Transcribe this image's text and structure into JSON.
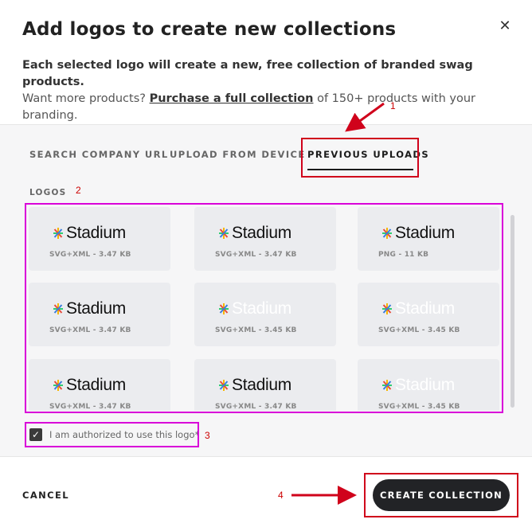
{
  "modal": {
    "title": "Add logos to create new collections",
    "description": {
      "line1": "Each selected logo will create a new, free collection of branded swag products.",
      "prefix": "Want more products? ",
      "link": "Purchase a full collection",
      "suffix": " of 150+ products with your branding."
    }
  },
  "tabs": [
    {
      "label": "SEARCH COMPANY URL",
      "active": false
    },
    {
      "label": "UPLOAD FROM DEVICE",
      "active": false
    },
    {
      "label": "PREVIOUS UPLOADS",
      "active": true
    }
  ],
  "logos_label": "LOGOS",
  "logos": [
    {
      "name": "Stadium",
      "meta": "SVG+XML - 3.47 KB",
      "white": false
    },
    {
      "name": "Stadium",
      "meta": "SVG+XML - 3.47 KB",
      "white": false
    },
    {
      "name": "Stadium",
      "meta": "PNG - 11 KB",
      "white": false
    },
    {
      "name": "Stadium",
      "meta": "SVG+XML - 3.47 KB",
      "white": false
    },
    {
      "name": "Stadium",
      "meta": "SVG+XML - 3.45 KB",
      "white": true
    },
    {
      "name": "Stadium",
      "meta": "SVG+XML - 3.45 KB",
      "white": true
    },
    {
      "name": "Stadium",
      "meta": "SVG+XML - 3.47 KB",
      "white": false
    },
    {
      "name": "Stadium",
      "meta": "SVG+XML - 3.47 KB",
      "white": false
    },
    {
      "name": "Stadium",
      "meta": "SVG+XML - 3.45 KB",
      "white": true
    }
  ],
  "authorization": {
    "label": "I am authorized to use this logo*",
    "checked": true
  },
  "footer": {
    "cancel_label": "CANCEL",
    "create_label": "CREATE COLLECTION"
  },
  "annotations": [
    "1",
    "2",
    "3",
    "4"
  ],
  "colors": {
    "accent": "#222326",
    "highlight_red": "#d0021b",
    "highlight_pink": "#d900d9"
  }
}
